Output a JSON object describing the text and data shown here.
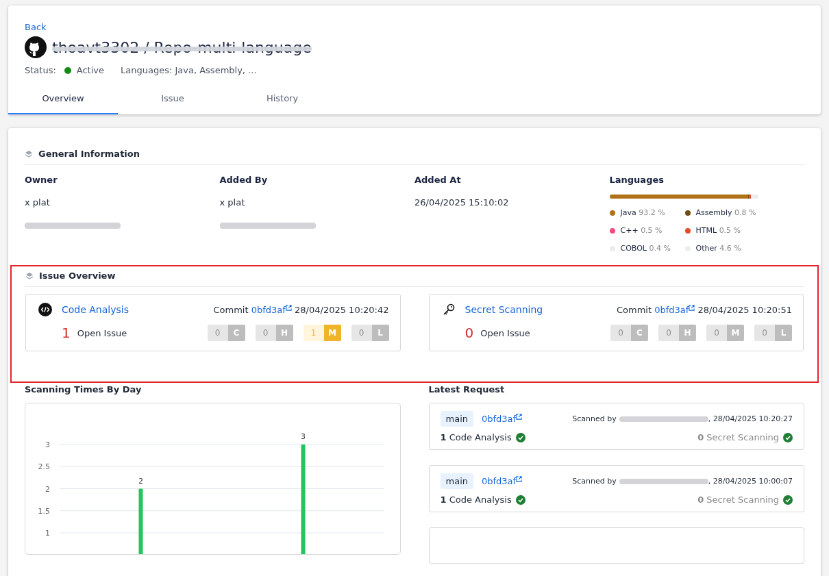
{
  "back_link": "Back",
  "repo": {
    "title": "thoavt3302 / Repo-multi-language",
    "redacted": true
  },
  "status": {
    "label": "Status:",
    "value": "Active",
    "active": true
  },
  "languages_summary": "Languages: Java, Assembly, ...",
  "tabs": [
    {
      "label": "Overview",
      "selected": true
    },
    {
      "label": "Issue",
      "selected": false
    },
    {
      "label": "History",
      "selected": false
    }
  ],
  "general_information": {
    "title": "General Information",
    "columns": [
      {
        "heading": "Owner",
        "value": "x plat",
        "email_redacted": true
      },
      {
        "heading": "Added By",
        "value": "x plat",
        "email_redacted": true
      },
      {
        "heading": "Added At",
        "value": "26/04/2025 15:10:02"
      }
    ],
    "languages": {
      "heading": "Languages",
      "items": [
        {
          "name": "Java",
          "percent": "93.2 %",
          "color": "#b07219"
        },
        {
          "name": "Assembly",
          "percent": "0.8 %",
          "color": "#6e4c13"
        },
        {
          "name": "C++",
          "percent": "0.5 %",
          "color": "#f34b7d"
        },
        {
          "name": "HTML",
          "percent": "0.5 %",
          "color": "#e34c26"
        },
        {
          "name": "COBOL",
          "percent": "0.4 %",
          "color": "#ececec"
        },
        {
          "name": "Other",
          "percent": "4.6 %",
          "color": "#ededed"
        }
      ]
    }
  },
  "issue_overview": {
    "title": "Issue Overview",
    "highlighted": true,
    "cards": [
      {
        "kind": "code",
        "title": "Code Analysis",
        "commit_label": "Commit",
        "commit": "0bfd3af",
        "time": "28/04/2025 10:20:42",
        "count": "1",
        "count_label": "Open Issue",
        "severities": [
          {
            "kind": "critical",
            "count": "0",
            "letter": "C",
            "active": false
          },
          {
            "kind": "high",
            "count": "0",
            "letter": "H",
            "active": false
          },
          {
            "kind": "medium",
            "count": "1",
            "letter": "M",
            "active": true
          },
          {
            "kind": "low",
            "count": "0",
            "letter": "L",
            "active": false
          }
        ]
      },
      {
        "kind": "secret",
        "title": "Secret Scanning",
        "commit_label": "Commit",
        "commit": "0bfd3af",
        "time": "28/04/2025 10:20:51",
        "count": "0",
        "count_label": "Open Issue",
        "severities": [
          {
            "kind": "critical",
            "count": "0",
            "letter": "C",
            "active": false
          },
          {
            "kind": "high",
            "count": "0",
            "letter": "H",
            "active": false
          },
          {
            "kind": "medium",
            "count": "0",
            "letter": "M",
            "active": false
          },
          {
            "kind": "low",
            "count": "0",
            "letter": "L",
            "active": false
          }
        ]
      }
    ]
  },
  "scanning_times": {
    "title": "Scanning Times By Day",
    "chart_data": {
      "type": "bar",
      "values": [
        2,
        3
      ],
      "ylim": [
        0,
        3
      ],
      "yticks": [
        1,
        1.5,
        2,
        2.5,
        3
      ],
      "data_labels": true,
      "grid": true
    }
  },
  "latest_request": {
    "title": "Latest Request",
    "items": [
      {
        "branch": "main",
        "commit": "0bfd3af",
        "scanned_by": "Scanned by",
        "time": ", 28/04/2025 10:20:27",
        "results": [
          {
            "count": "1",
            "label": "Code Analysis",
            "muted": false
          },
          {
            "count": "0",
            "label": "Secret Scanning",
            "muted": true
          }
        ]
      },
      {
        "branch": "main",
        "commit": "0bfd3af",
        "scanned_by": "Scanned by",
        "time": ", 28/04/2025 10:00:07",
        "results": [
          {
            "count": "1",
            "label": "Code Analysis",
            "muted": false
          },
          {
            "count": "0",
            "label": "Secret Scanning",
            "muted": true
          }
        ]
      },
      {
        "kind": "cut"
      }
    ]
  }
}
